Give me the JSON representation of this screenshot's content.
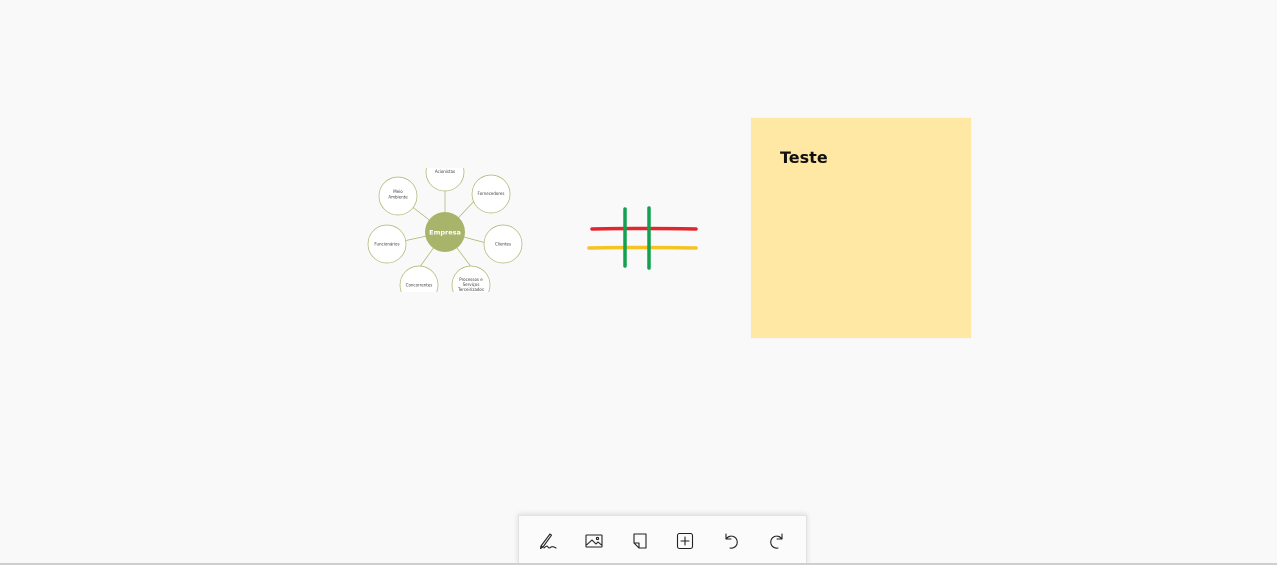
{
  "mindmap": {
    "center": "Empresa",
    "nodes": {
      "top": "Acionistas",
      "top_right": "Fornecedores",
      "right": "Clientes",
      "bottom_right_lines": [
        "Processos e",
        "Serviços",
        "Terceirizados"
      ],
      "bottom_left": "Concorrentes",
      "left": "Funcionários",
      "top_left_lines": [
        "Meio",
        "Ambiente"
      ]
    },
    "colors": {
      "center_fill": "#a8b46a",
      "node_stroke": "#a8b46a",
      "connector": "#a8b46a"
    }
  },
  "ink": {
    "colors": {
      "red": "#e0262f",
      "yellow": "#f6c325",
      "green": "#12a150"
    }
  },
  "sticky_note": {
    "text": "Teste",
    "color": "#ffe8a4"
  },
  "toolbar": {
    "items": [
      {
        "name": "pen-tool-button",
        "icon": "pen-icon"
      },
      {
        "name": "image-button",
        "icon": "image-icon"
      },
      {
        "name": "sticky-note-button",
        "icon": "note-icon"
      },
      {
        "name": "add-button",
        "icon": "plus-square-icon"
      },
      {
        "name": "undo-button",
        "icon": "undo-icon"
      },
      {
        "name": "redo-button",
        "icon": "redo-icon"
      }
    ]
  }
}
